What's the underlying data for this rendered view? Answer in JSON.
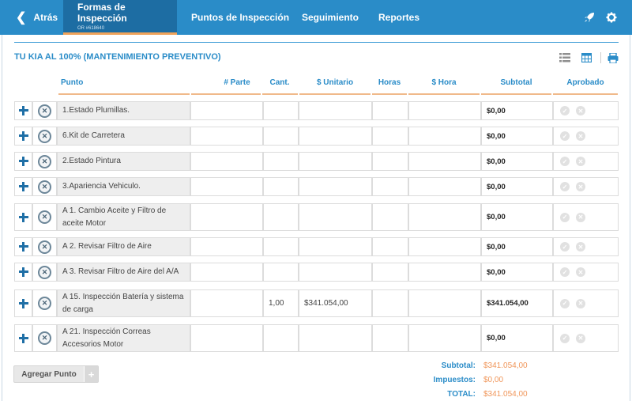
{
  "nav": {
    "back_label": "Atrás",
    "active_tab": "Formas de Inspección",
    "active_tab_sub": "OR #618640",
    "tabs": [
      "Puntos de Inspección",
      "Seguimiento",
      "Reportes"
    ],
    "icons": [
      "rocket-icon",
      "gear-icon"
    ],
    "bg_color": "#2a8cc8",
    "active_color": "#1d6da3"
  },
  "form": {
    "title": "TU KIA AL 100% (MANTENIMIENTO PREVENTIVO)",
    "tools": [
      "list-view-icon",
      "table-view-icon",
      "print-icon"
    ]
  },
  "table": {
    "columns": [
      "Punto",
      "# Parte",
      "Cant.",
      "$ Unitario",
      "Horas",
      "$ Hora",
      "Subtotal",
      "Aprobado"
    ],
    "rows": [
      {
        "punto": "1.Estado Plumillas.",
        "parte": "",
        "cant": "",
        "unitario": "",
        "horas": "",
        "hora": "",
        "subtotal": "$0,00"
      },
      {
        "punto": "6.Kit de Carretera",
        "parte": "",
        "cant": "",
        "unitario": "",
        "horas": "",
        "hora": "",
        "subtotal": "$0,00"
      },
      {
        "punto": "2.Estado Pintura",
        "parte": "",
        "cant": "",
        "unitario": "",
        "horas": "",
        "hora": "",
        "subtotal": "$0,00"
      },
      {
        "punto": "3.Apariencia Vehiculo.",
        "parte": "",
        "cant": "",
        "unitario": "",
        "horas": "",
        "hora": "",
        "subtotal": "$0,00"
      },
      {
        "punto": "A 1. Cambio Aceite y Filtro de aceite Motor",
        "parte": "",
        "cant": "",
        "unitario": "",
        "horas": "",
        "hora": "",
        "subtotal": "$0,00"
      },
      {
        "punto": "A 2. Revisar Filtro de Aire",
        "parte": "",
        "cant": "",
        "unitario": "",
        "horas": "",
        "hora": "",
        "subtotal": "$0,00"
      },
      {
        "punto": "A 3. Revisar Filtro de Aire del A/A",
        "parte": "",
        "cant": "",
        "unitario": "",
        "horas": "",
        "hora": "",
        "subtotal": "$0,00"
      },
      {
        "punto": "A 15. Inspección Batería y sistema de carga",
        "parte": "",
        "cant": "1,00",
        "unitario": "$341.054,00",
        "horas": "",
        "hora": "",
        "subtotal": "$341.054,00"
      },
      {
        "punto": "A 21. Inspección Correas Accesorios Motor",
        "parte": "",
        "cant": "",
        "unitario": "",
        "horas": "",
        "hora": "",
        "subtotal": "$0,00"
      }
    ]
  },
  "footer": {
    "add_button": "Agregar Punto",
    "subtotal_label": "Subtotal:",
    "subtotal_value": "$341.054,00",
    "impuestos_label": "Impuestos:",
    "impuestos_value": "$0,00",
    "total_label": "TOTAL:",
    "total_value": "$341.054,00"
  }
}
